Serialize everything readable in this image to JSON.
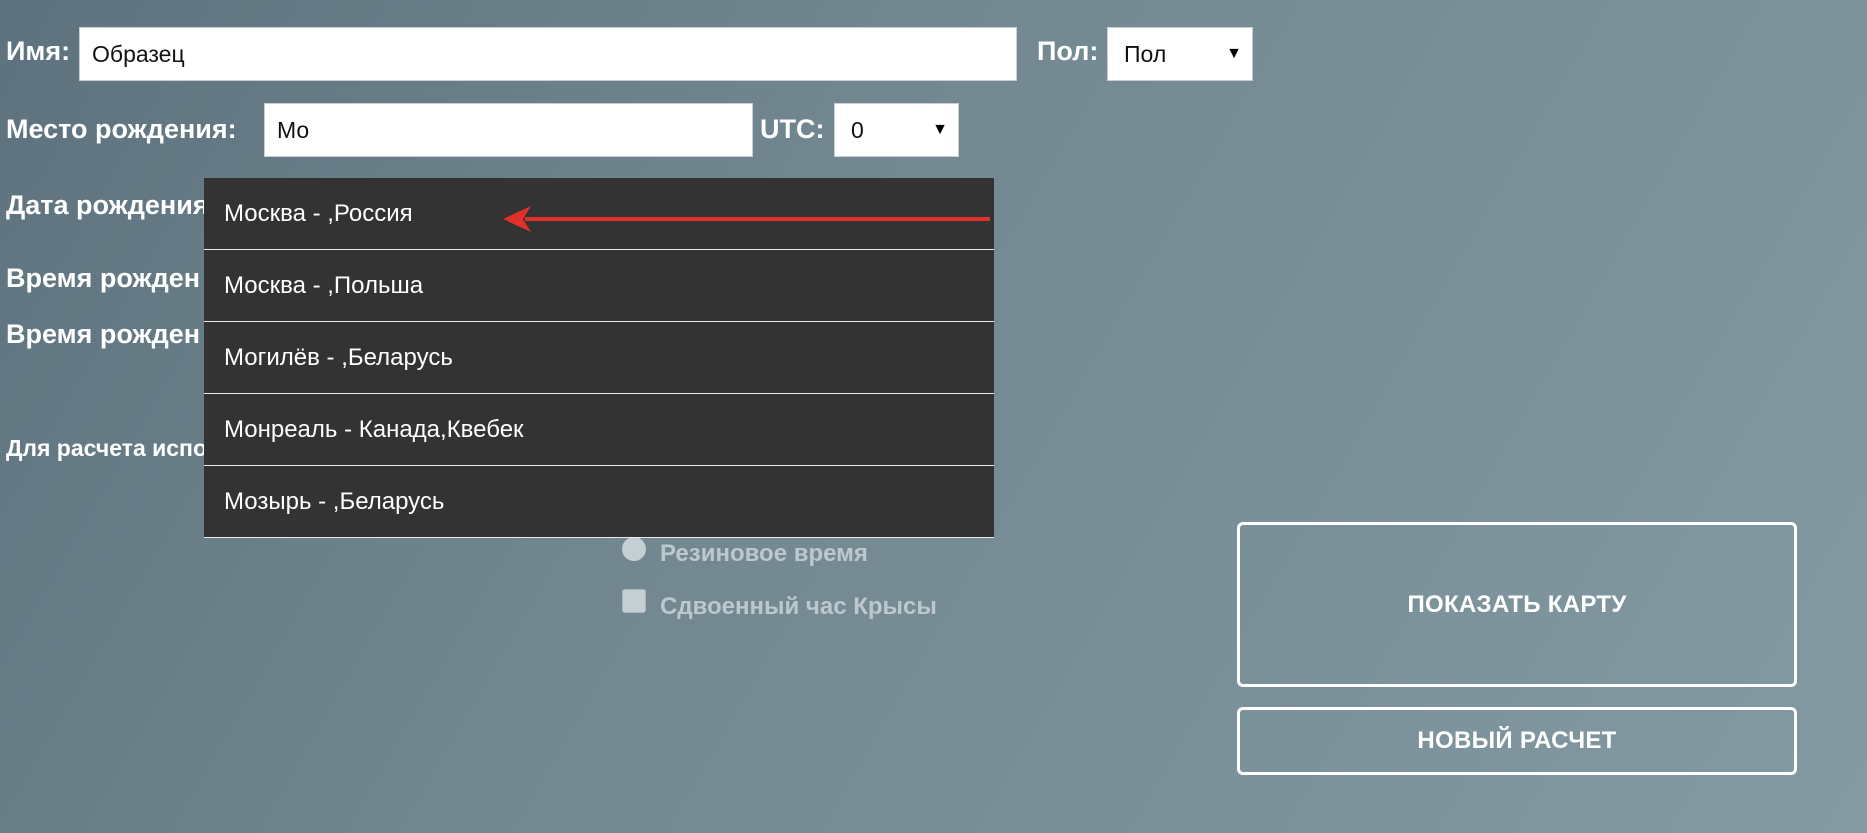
{
  "form": {
    "name_label": "Имя:",
    "name_value": "Образец",
    "gender_label": "Пол:",
    "gender_value": "Пол",
    "birthplace_label": "Место рождения:",
    "birthplace_value": "Мо",
    "utc_label": "UTC:",
    "utc_value": "0",
    "birthdate_label": "Дата рождения",
    "birthtime_label_1": "Время рожден",
    "birthtime_label_2": "Время рожден",
    "calc_note": "Для расчета испо"
  },
  "autocomplete": {
    "items": [
      "Москва - ,Россия",
      "Москва - ,Польша",
      "Могилёв - ,Беларусь",
      "Монреаль - Канада,Квебек",
      "Мозырь - ,Беларусь"
    ]
  },
  "options": {
    "rubber_time": "Резиновое время",
    "double_rat_hour": "Сдвоенный час Крысы"
  },
  "buttons": {
    "show_map": "ПОКАЗАТЬ КАРТУ",
    "new_calc": "НОВЫЙ РАСЧЕТ"
  },
  "colors": {
    "annotation_arrow": "#e0302a",
    "dropdown_bg": "#333333"
  }
}
